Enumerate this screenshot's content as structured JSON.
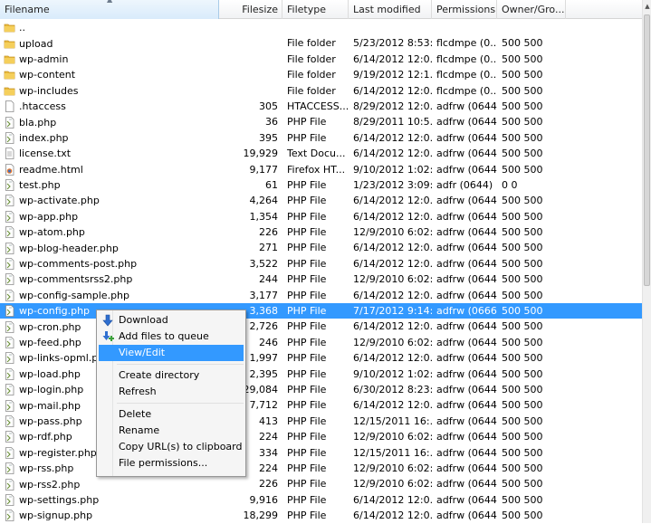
{
  "columns": {
    "filename": "Filename",
    "filesize": "Filesize",
    "filetype": "Filetype",
    "modified": "Last modified",
    "permissions": "Permissions",
    "owner": "Owner/Gro..."
  },
  "files": [
    {
      "name": "..",
      "size": "",
      "type": "",
      "modified": "",
      "perms": "",
      "owner": "",
      "icon": "folder-icon"
    },
    {
      "name": "upload",
      "size": "",
      "type": "File folder",
      "modified": "5/23/2012 8:53:...",
      "perms": "flcdmpe (0...",
      "owner": "500 500",
      "icon": "folder-icon"
    },
    {
      "name": "wp-admin",
      "size": "",
      "type": "File folder",
      "modified": "6/14/2012 12:0...",
      "perms": "flcdmpe (0...",
      "owner": "500 500",
      "icon": "folder-icon"
    },
    {
      "name": "wp-content",
      "size": "",
      "type": "File folder",
      "modified": "9/19/2012 12:1...",
      "perms": "flcdmpe (0...",
      "owner": "500 500",
      "icon": "folder-icon"
    },
    {
      "name": "wp-includes",
      "size": "",
      "type": "File folder",
      "modified": "6/14/2012 12:0...",
      "perms": "flcdmpe (0...",
      "owner": "500 500",
      "icon": "folder-icon"
    },
    {
      "name": ".htaccess",
      "size": "305",
      "type": "HTACCESS...",
      "modified": "8/29/2012 12:0...",
      "perms": "adfrw (0644)",
      "owner": "500 500",
      "icon": "file-icon"
    },
    {
      "name": "bla.php",
      "size": "36",
      "type": "PHP File",
      "modified": "8/29/2011 10:5...",
      "perms": "adfrw (0644)",
      "owner": "500 500",
      "icon": "php-file-icon"
    },
    {
      "name": "index.php",
      "size": "395",
      "type": "PHP File",
      "modified": "6/14/2012 12:0...",
      "perms": "adfrw (0644)",
      "owner": "500 500",
      "icon": "php-file-icon"
    },
    {
      "name": "license.txt",
      "size": "19,929",
      "type": "Text Docu...",
      "modified": "6/14/2012 12:0...",
      "perms": "adfrw (0644)",
      "owner": "500 500",
      "icon": "text-file-icon"
    },
    {
      "name": "readme.html",
      "size": "9,177",
      "type": "Firefox HT...",
      "modified": "9/10/2012 1:02:...",
      "perms": "adfrw (0644)",
      "owner": "500 500",
      "icon": "html-file-icon"
    },
    {
      "name": "test.php",
      "size": "61",
      "type": "PHP File",
      "modified": "1/23/2012 3:09:...",
      "perms": "adfr (0644)",
      "owner": "0 0",
      "icon": "php-file-icon"
    },
    {
      "name": "wp-activate.php",
      "size": "4,264",
      "type": "PHP File",
      "modified": "6/14/2012 12:0...",
      "perms": "adfrw (0644)",
      "owner": "500 500",
      "icon": "php-file-icon"
    },
    {
      "name": "wp-app.php",
      "size": "1,354",
      "type": "PHP File",
      "modified": "6/14/2012 12:0...",
      "perms": "adfrw (0644)",
      "owner": "500 500",
      "icon": "php-file-icon"
    },
    {
      "name": "wp-atom.php",
      "size": "226",
      "type": "PHP File",
      "modified": "12/9/2010 6:02:...",
      "perms": "adfrw (0644)",
      "owner": "500 500",
      "icon": "php-file-icon"
    },
    {
      "name": "wp-blog-header.php",
      "size": "271",
      "type": "PHP File",
      "modified": "6/14/2012 12:0...",
      "perms": "adfrw (0644)",
      "owner": "500 500",
      "icon": "php-file-icon"
    },
    {
      "name": "wp-comments-post.php",
      "size": "3,522",
      "type": "PHP File",
      "modified": "6/14/2012 12:0...",
      "perms": "adfrw (0644)",
      "owner": "500 500",
      "icon": "php-file-icon"
    },
    {
      "name": "wp-commentsrss2.php",
      "size": "244",
      "type": "PHP File",
      "modified": "12/9/2010 6:02:...",
      "perms": "adfrw (0644)",
      "owner": "500 500",
      "icon": "php-file-icon"
    },
    {
      "name": "wp-config-sample.php",
      "size": "3,177",
      "type": "PHP File",
      "modified": "6/14/2012 12:0...",
      "perms": "adfrw (0644)",
      "owner": "500 500",
      "icon": "php-file-icon"
    },
    {
      "name": "wp-config.php",
      "size": "3,368",
      "type": "PHP File",
      "modified": "7/17/2012 9:14:...",
      "perms": "adfrw (0666)",
      "owner": "500 500",
      "icon": "php-file-icon",
      "selected": true
    },
    {
      "name": "wp-cron.php",
      "size": "2,726",
      "type": "PHP File",
      "modified": "6/14/2012 12:0...",
      "perms": "adfrw (0644)",
      "owner": "500 500",
      "icon": "php-file-icon"
    },
    {
      "name": "wp-feed.php",
      "size": "246",
      "type": "PHP File",
      "modified": "12/9/2010 6:02:...",
      "perms": "adfrw (0644)",
      "owner": "500 500",
      "icon": "php-file-icon"
    },
    {
      "name": "wp-links-opml.php",
      "size": "1,997",
      "type": "PHP File",
      "modified": "6/14/2012 12:0...",
      "perms": "adfrw (0644)",
      "owner": "500 500",
      "icon": "php-file-icon"
    },
    {
      "name": "wp-load.php",
      "size": "2,395",
      "type": "PHP File",
      "modified": "9/10/2012 1:02:...",
      "perms": "adfrw (0644)",
      "owner": "500 500",
      "icon": "php-file-icon"
    },
    {
      "name": "wp-login.php",
      "size": "29,084",
      "type": "PHP File",
      "modified": "6/30/2012 8:23:...",
      "perms": "adfrw (0644)",
      "owner": "500 500",
      "icon": "php-file-icon"
    },
    {
      "name": "wp-mail.php",
      "size": "7,712",
      "type": "PHP File",
      "modified": "6/14/2012 12:0...",
      "perms": "adfrw (0644)",
      "owner": "500 500",
      "icon": "php-file-icon"
    },
    {
      "name": "wp-pass.php",
      "size": "413",
      "type": "PHP File",
      "modified": "12/15/2011 16:...",
      "perms": "adfrw (0644)",
      "owner": "500 500",
      "icon": "php-file-icon"
    },
    {
      "name": "wp-rdf.php",
      "size": "224",
      "type": "PHP File",
      "modified": "12/9/2010 6:02:...",
      "perms": "adfrw (0644)",
      "owner": "500 500",
      "icon": "php-file-icon"
    },
    {
      "name": "wp-register.php",
      "size": "334",
      "type": "PHP File",
      "modified": "12/15/2011 16:...",
      "perms": "adfrw (0644)",
      "owner": "500 500",
      "icon": "php-file-icon"
    },
    {
      "name": "wp-rss.php",
      "size": "224",
      "type": "PHP File",
      "modified": "12/9/2010 6:02:...",
      "perms": "adfrw (0644)",
      "owner": "500 500",
      "icon": "php-file-icon"
    },
    {
      "name": "wp-rss2.php",
      "size": "226",
      "type": "PHP File",
      "modified": "12/9/2010 6:02:...",
      "perms": "adfrw (0644)",
      "owner": "500 500",
      "icon": "php-file-icon"
    },
    {
      "name": "wp-settings.php",
      "size": "9,916",
      "type": "PHP File",
      "modified": "6/14/2012 12:0...",
      "perms": "adfrw (0644)",
      "owner": "500 500",
      "icon": "php-file-icon"
    },
    {
      "name": "wp-signup.php",
      "size": "18,299",
      "type": "PHP File",
      "modified": "6/14/2012 12:0...",
      "perms": "adfrw (0644)",
      "owner": "500 500",
      "icon": "php-file-icon"
    }
  ],
  "context_menu": {
    "items": [
      {
        "label": "Download",
        "icon": "download-arrow-icon"
      },
      {
        "label": "Add files to queue",
        "icon": "add-to-queue-icon"
      },
      {
        "label": "View/Edit",
        "highlighted": true
      },
      {
        "separator": true
      },
      {
        "label": "Create directory"
      },
      {
        "label": "Refresh"
      },
      {
        "separator": true
      },
      {
        "label": "Delete"
      },
      {
        "label": "Rename"
      },
      {
        "label": "Copy URL(s) to clipboard"
      },
      {
        "label": "File permissions..."
      }
    ]
  },
  "colors": {
    "selection": "#3399ff",
    "folder": "#e8b93a",
    "header_active": "#d9ebfb"
  }
}
